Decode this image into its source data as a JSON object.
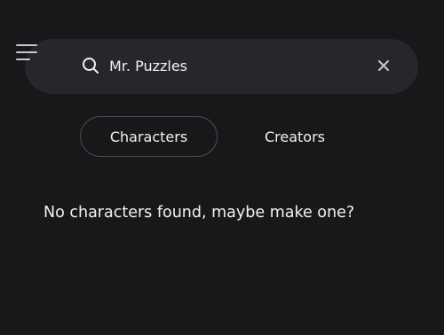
{
  "header": {
    "menu_icon": "hamburger-menu-icon"
  },
  "search": {
    "value": "Mr. Puzzles",
    "search_icon": "search-icon",
    "clear_icon": "close-icon"
  },
  "tabs": [
    {
      "label": "Characters",
      "selected": true
    },
    {
      "label": "Creators",
      "selected": false
    }
  ],
  "results": {
    "empty_message": "No characters found, maybe make one?"
  },
  "colors": {
    "background": "#18181b",
    "search_bar": "#26262b",
    "text": "#f2f2f2",
    "tab_border": "#4a4a50"
  }
}
